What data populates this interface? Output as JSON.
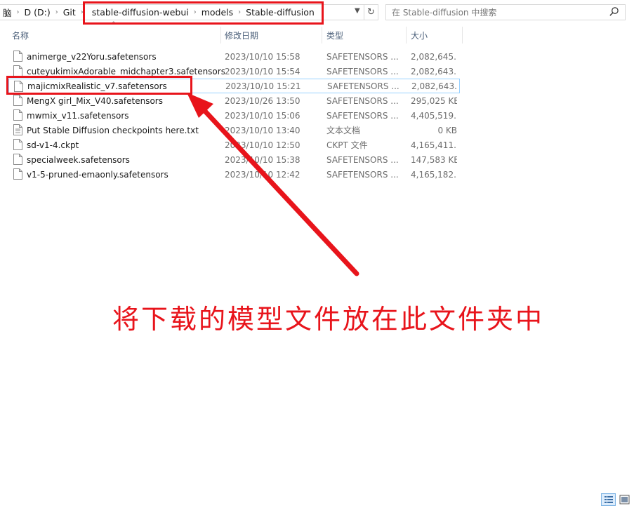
{
  "address": {
    "crumbs": [
      "脑",
      "D (D:)",
      "Git",
      "stable-diffusion-webui",
      "models",
      "Stable-diffusion"
    ]
  },
  "search": {
    "placeholder": "在 Stable-diffusion 中搜索"
  },
  "columns": {
    "name": "名称",
    "date": "修改日期",
    "type": "类型",
    "size": "大小"
  },
  "files": [
    {
      "name": "animerge_v22Yoru.safetensors",
      "date": "2023/10/10 15:58",
      "type": "SAFETENSORS ...",
      "size": "2,082,645..."
    },
    {
      "name": "cuteyukimixAdorable_midchapter3.safetensors",
      "date": "2023/10/10 15:54",
      "type": "SAFETENSORS ...",
      "size": "2,082,643..."
    },
    {
      "name": "majicmixRealistic_v7.safetensors",
      "date": "2023/10/10 15:21",
      "type": "SAFETENSORS ...",
      "size": "2,082,643..."
    },
    {
      "name": "MengX girl_Mix_V40.safetensors",
      "date": "2023/10/26 13:50",
      "type": "SAFETENSORS ...",
      "size": "295,025 KB"
    },
    {
      "name": "mwmix_v11.safetensors",
      "date": "2023/10/10 15:06",
      "type": "SAFETENSORS ...",
      "size": "4,405,519..."
    },
    {
      "name": "Put Stable Diffusion checkpoints here.txt",
      "date": "2023/10/10 13:40",
      "type": "文本文档",
      "size": "0 KB"
    },
    {
      "name": "sd-v1-4.ckpt",
      "date": "2023/10/10 12:50",
      "type": "CKPT 文件",
      "size": "4,165,411..."
    },
    {
      "name": "specialweek.safetensors",
      "date": "2023/10/10 15:38",
      "type": "SAFETENSORS ...",
      "size": "147,583 KB"
    },
    {
      "name": "v1-5-pruned-emaonly.safetensors",
      "date": "2023/10/10 12:42",
      "type": "SAFETENSORS ...",
      "size": "4,165,182..."
    }
  ],
  "annotation": {
    "text": "将下载的模型文件放在此文件夹中",
    "color": "#e8141b"
  },
  "colors": {
    "selection_border": "#99d1ff",
    "header_text": "#4c607a"
  }
}
